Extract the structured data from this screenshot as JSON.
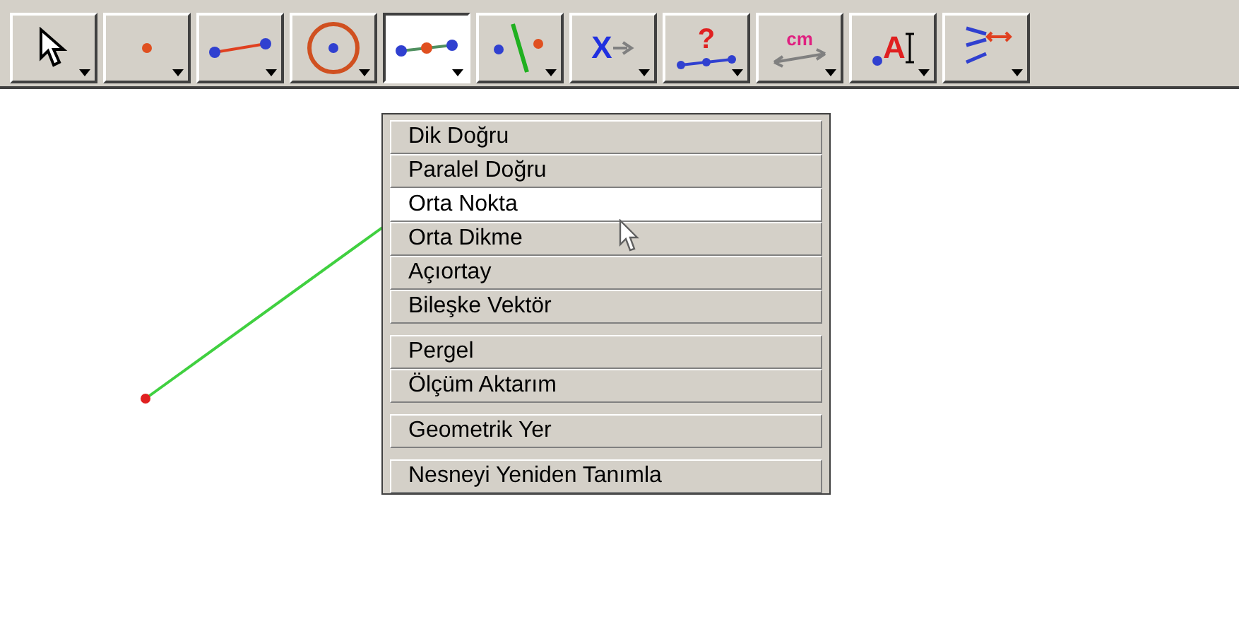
{
  "toolbar": [
    {
      "kind": "pointer",
      "selected": false
    },
    {
      "kind": "point",
      "selected": false
    },
    {
      "kind": "segment",
      "selected": false
    },
    {
      "kind": "circle",
      "selected": false
    },
    {
      "kind": "midpoint",
      "selected": true
    },
    {
      "kind": "perpendicular",
      "selected": false
    },
    {
      "kind": "expression",
      "glyph": "X",
      "selected": false
    },
    {
      "kind": "question",
      "glyph": "?",
      "selected": false
    },
    {
      "kind": "measure",
      "glyph": "cm",
      "selected": false
    },
    {
      "kind": "text",
      "glyph": "A",
      "selected": false
    },
    {
      "kind": "transform",
      "selected": false
    }
  ],
  "menu": {
    "groups": [
      [
        {
          "label": "Dik Doğru",
          "selected": false
        },
        {
          "label": "Paralel Doğru",
          "selected": false
        },
        {
          "label": "Orta Nokta",
          "selected": true
        },
        {
          "label": "Orta Dikme",
          "selected": false
        },
        {
          "label": "Açıortay",
          "selected": false
        },
        {
          "label": "Bileşke Vektör",
          "selected": false
        }
      ],
      [
        {
          "label": "Pergel",
          "selected": false
        },
        {
          "label": "Ölçüm Aktarım",
          "selected": false
        }
      ],
      [
        {
          "label": "Geometrik Yer",
          "selected": false
        }
      ],
      [
        {
          "label": "Nesneyi Yeniden Tanımla",
          "selected": false
        }
      ]
    ]
  }
}
